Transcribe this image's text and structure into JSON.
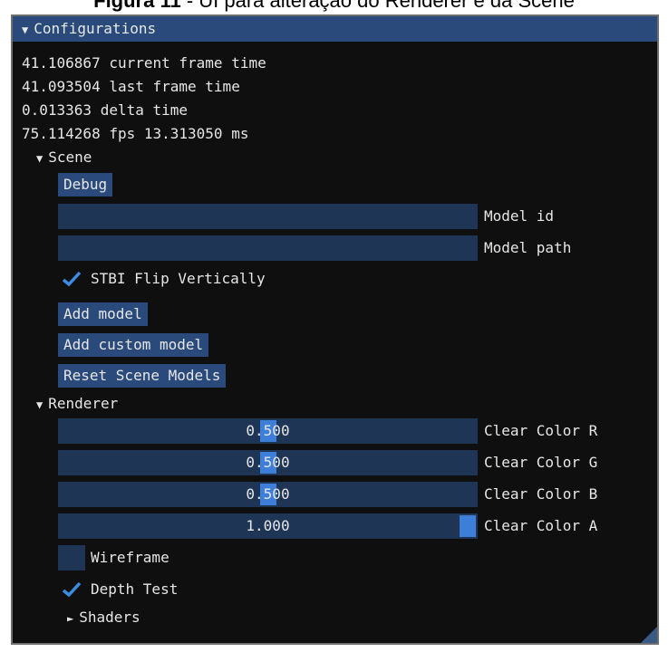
{
  "caption": {
    "prefix": "Figura 11",
    "text": " - UI para alteração do Renderer e da Scene"
  },
  "window": {
    "title": "Configurations",
    "stats": [
      "41.106867 current frame time",
      "41.093504 last frame time",
      "0.013363 delta time",
      "75.114268 fps 13.313050 ms"
    ]
  },
  "scene": {
    "header": "Scene",
    "debug_label": "Debug",
    "model_id": {
      "value": "",
      "label": "Model id"
    },
    "model_path": {
      "value": "",
      "label": "Model path"
    },
    "stbi_flip": {
      "label": "STBI Flip Vertically",
      "checked": true
    },
    "add_model_label": "Add model",
    "add_custom_model_label": "Add custom model",
    "reset_models_label": "Reset Scene Models"
  },
  "renderer": {
    "header": "Renderer",
    "sliders": [
      {
        "value": "0.500",
        "fraction": 0.5,
        "label": "Clear Color R"
      },
      {
        "value": "0.500",
        "fraction": 0.5,
        "label": "Clear Color G"
      },
      {
        "value": "0.500",
        "fraction": 0.5,
        "label": "Clear Color B"
      },
      {
        "value": "1.000",
        "fraction": 1.0,
        "label": "Clear Color A"
      }
    ],
    "wireframe": {
      "label": "Wireframe",
      "checked": false
    },
    "depth_test": {
      "label": "Depth Test",
      "checked": true
    },
    "shaders_label": "Shaders"
  },
  "colors": {
    "accent": "#3d7fd8",
    "title_bar": "#294a7a",
    "frame_bg": "#1f3556",
    "window_bg": "#0f0f10"
  },
  "icons": {
    "expanded": "triangle-down-icon",
    "collapsed": "triangle-right-icon",
    "check": "checkmark-icon"
  }
}
